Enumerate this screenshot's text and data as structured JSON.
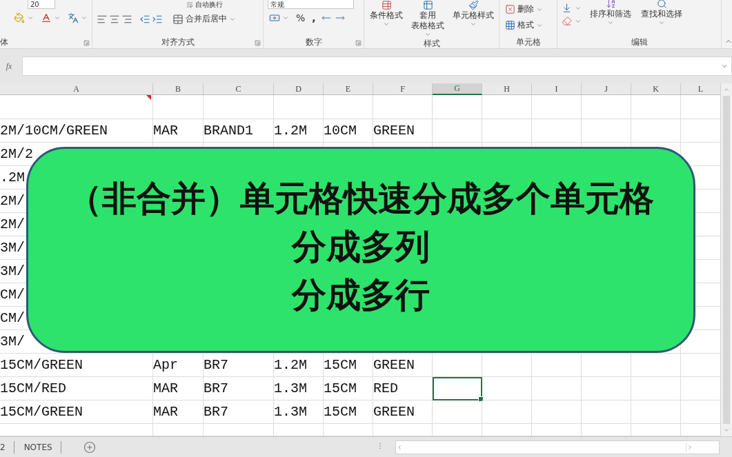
{
  "ribbon": {
    "font_group": {
      "label": "体",
      "font_size": "20"
    },
    "alignment_group": {
      "label": "对齐方式",
      "wrap_button": "自动换行",
      "merge_button": "合并后居中"
    },
    "number_group": {
      "label": "数字",
      "format": "常规",
      "percent": "%",
      "comma": ","
    },
    "styles_group": {
      "label": "样式",
      "buttons": [
        {
          "lines": [
            "条件格式"
          ]
        },
        {
          "lines": [
            "套用",
            "表格格式"
          ]
        },
        {
          "lines": [
            "单元格样式"
          ]
        }
      ]
    },
    "cells_group": {
      "label": "单元格",
      "buttons": [
        "删除",
        "格式"
      ]
    },
    "editing_group": {
      "label": "编辑",
      "buttons": [
        "排序和筛选",
        "查找和选择"
      ]
    }
  },
  "formula_bar": {
    "label": "fx"
  },
  "columns": [
    {
      "label": "A",
      "selected": false
    },
    {
      "label": "B",
      "selected": false
    },
    {
      "label": "C",
      "selected": false
    },
    {
      "label": "D",
      "selected": false
    },
    {
      "label": "E",
      "selected": false
    },
    {
      "label": "F",
      "selected": false
    },
    {
      "label": "G",
      "selected": true
    },
    {
      "label": "H",
      "selected": false
    },
    {
      "label": "I",
      "selected": false
    },
    {
      "label": "J",
      "selected": false
    },
    {
      "label": "K",
      "selected": false
    },
    {
      "label": "L",
      "selected": false
    }
  ],
  "rows": [
    {
      "cells": [
        "2M/10CM/GREEN",
        "MAR",
        "BRAND1",
        "1.2M",
        "10CM",
        "GREEN"
      ],
      "selected": false
    },
    {
      "cells": [
        "2M/2"
      ],
      "selected": false
    },
    {
      "cells": [
        ".2M"
      ],
      "selected": false
    },
    {
      "cells": [
        "2M/"
      ],
      "selected": false
    },
    {
      "cells": [
        "2M/"
      ],
      "selected": false
    },
    {
      "cells": [
        "3M/"
      ],
      "selected": false
    },
    {
      "cells": [
        "3M/"
      ],
      "selected": false
    },
    {
      "cells": [
        "CM/"
      ],
      "selected": false
    },
    {
      "cells": [
        "CM/"
      ],
      "selected": false
    },
    {
      "cells": [
        "3M/"
      ],
      "selected": false
    },
    {
      "cells": [
        "15CM/GREEN",
        "Apr",
        "BR7",
        "1.2M",
        "15CM",
        "GREEN"
      ],
      "selected": false
    },
    {
      "cells": [
        "15CM/RED",
        "MAR",
        "BR7",
        "1.3M",
        "15CM",
        "RED"
      ],
      "selected": true
    },
    {
      "cells": [
        "15CM/GREEN",
        "MAR",
        "BR7",
        "1.3M",
        "15CM",
        "GREEN"
      ],
      "selected": false
    }
  ],
  "overlay": {
    "lines": [
      "（非合并）单元格快速分成多个单元格",
      "分成多列",
      "分成多行"
    ]
  },
  "sheet_tabs": [
    "2",
    "NOTES"
  ]
}
